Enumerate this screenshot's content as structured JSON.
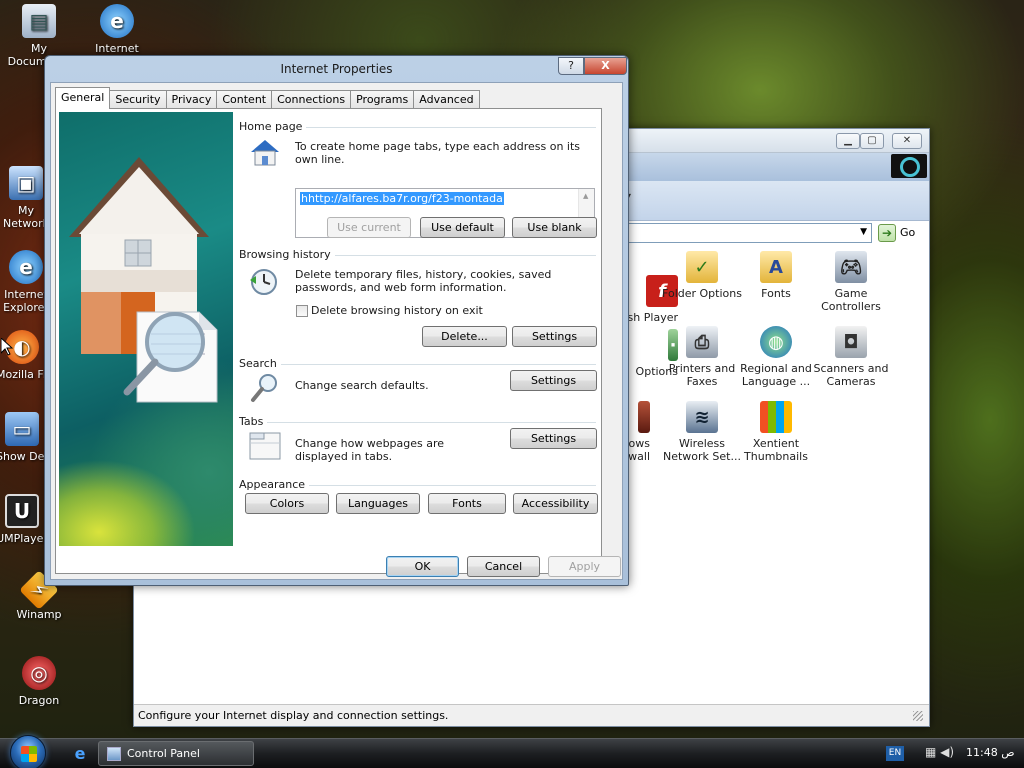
{
  "desktop": {
    "icons": [
      {
        "label": "My Documents"
      },
      {
        "label": "Internet Explorer"
      },
      {
        "label": "My Network Places"
      },
      {
        "label": "Internet Explorer"
      },
      {
        "label": "Mozilla Firefox"
      },
      {
        "label": "Show Desktop"
      },
      {
        "label": "UMPlayer"
      },
      {
        "label": "Winamp"
      },
      {
        "label": "Dragon"
      }
    ]
  },
  "control_panel": {
    "address_go": "Go",
    "status_text": "Configure your Internet display and connection settings.",
    "items": [
      {
        "label": "Flash Player",
        "icon": "flash-icon"
      },
      {
        "label": "Folder Options",
        "icon": "folder-options-icon"
      },
      {
        "label": "Fonts",
        "icon": "fonts-icon"
      },
      {
        "label": "Game Controllers",
        "icon": "game-controller-icon"
      },
      {
        "label": "Options",
        "icon": "options-icon"
      },
      {
        "label": "Printers and Faxes",
        "icon": "printer-icon"
      },
      {
        "label": "Regional and Language ...",
        "icon": "globe-icon"
      },
      {
        "label": "Scanners and Cameras",
        "icon": "scanner-icon"
      },
      {
        "label": "Windows Firewall",
        "icon": "firewall-icon"
      },
      {
        "label": "Wireless Network Set...",
        "icon": "wireless-icon"
      },
      {
        "label": "Xentient Thumbnails",
        "icon": "thumbnails-icon"
      }
    ]
  },
  "dialog": {
    "title": "Internet Properties",
    "help_label": "?",
    "close_label": "X",
    "tabs": [
      "General",
      "Security",
      "Privacy",
      "Content",
      "Connections",
      "Programs",
      "Advanced"
    ],
    "home_page": {
      "title": "Home page",
      "desc": "To create home page tabs, type each address on its own line.",
      "url": "hhttp://alfares.ba7r.org/f23-montada",
      "use_current": "Use current",
      "use_default": "Use default",
      "use_blank": "Use blank"
    },
    "browsing_history": {
      "title": "Browsing history",
      "desc": "Delete temporary files, history, cookies, saved passwords, and web form information.",
      "checkbox_label": "Delete browsing history on exit",
      "delete_btn": "Delete...",
      "settings_btn": "Settings"
    },
    "search": {
      "title": "Search",
      "desc": "Change search defaults.",
      "settings_btn": "Settings"
    },
    "tabs_section": {
      "title": "Tabs",
      "desc": "Change how webpages are displayed in tabs.",
      "settings_btn": "Settings"
    },
    "appearance": {
      "title": "Appearance",
      "colors": "Colors",
      "languages": "Languages",
      "fonts": "Fonts",
      "accessibility": "Accessibility"
    },
    "ok": "OK",
    "cancel": "Cancel",
    "apply": "Apply"
  },
  "taskbar": {
    "task_label": "Control Panel",
    "lang": "EN",
    "clock": "11:48 ص"
  }
}
